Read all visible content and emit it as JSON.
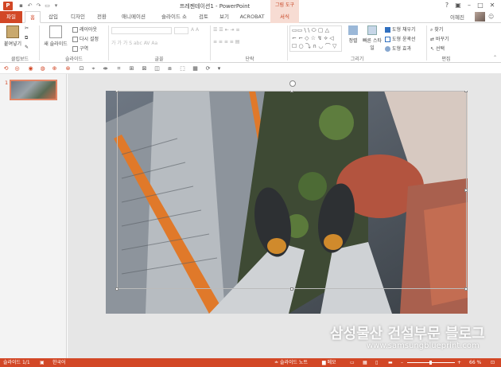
{
  "titlebar": {
    "app_icon": "P",
    "title": "프레젠테이션1 - PowerPoint",
    "context_tool": "그림 도구",
    "help": "?",
    "window_controls": [
      "restore-icon",
      "minimize-icon",
      "maximize-icon",
      "close-icon"
    ]
  },
  "tabs": [
    {
      "label": "파일"
    },
    {
      "label": "홈"
    },
    {
      "label": "삽입"
    },
    {
      "label": "디자인"
    },
    {
      "label": "전환"
    },
    {
      "label": "애니메이션"
    },
    {
      "label": "슬라이드 쇼"
    },
    {
      "label": "검토"
    },
    {
      "label": "보기"
    },
    {
      "label": "ACROBAT"
    },
    {
      "label": "서식"
    }
  ],
  "user": {
    "name": "이혜진"
  },
  "ribbon": {
    "clipboard": {
      "paste": "붙여넣기",
      "label": "클립보드"
    },
    "slides": {
      "new_slide": "새 슬라이드",
      "layout": "레이아웃",
      "reset": "다시 설정",
      "section": "구역",
      "label": "슬라이드"
    },
    "font": {
      "label": "글꼴"
    },
    "paragraph": {
      "label": "단락"
    },
    "drawing": {
      "arrange": "정렬",
      "quick_styles": "빠른 스타일",
      "fill": "도형 채우기",
      "outline": "도형 윤곽선",
      "effects": "도형 효과",
      "label": "그리기"
    },
    "editing": {
      "find": "찾기",
      "replace": "바꾸기",
      "select": "선택",
      "label": "편집"
    }
  },
  "slide_panel": {
    "number": "1"
  },
  "watermark": {
    "text": "삼성물산 건설부문 블로그",
    "url": "www.samsungblueprint.com"
  },
  "status": {
    "slide": "슬라이드 1/1",
    "language": "한국어",
    "notes": "슬라이드 노트",
    "comments": "메모",
    "zoom": "66 %"
  },
  "colors": {
    "accent": "#d24726",
    "context": "#f7dcd3"
  }
}
